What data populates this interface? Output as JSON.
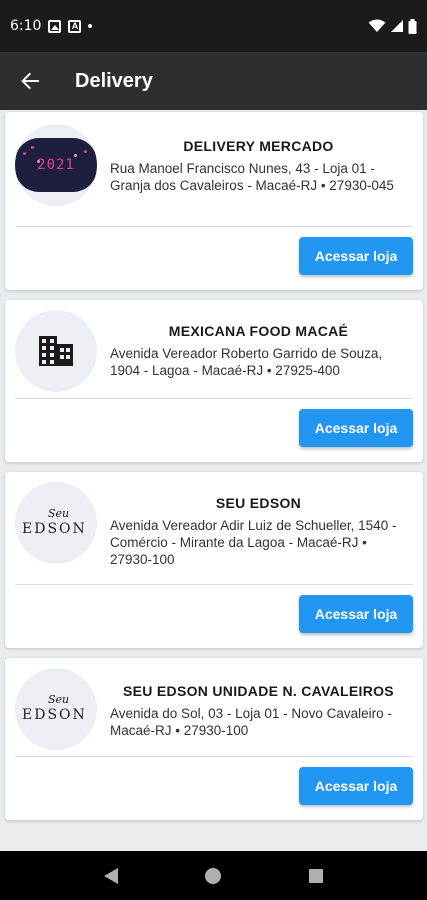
{
  "status_bar": {
    "time": "6:10"
  },
  "app_bar": {
    "title": "Delivery"
  },
  "stores": [
    {
      "name": "DELIVERY  MERCADO",
      "address": "Rua Manoel Francisco Nunes, 43 - Loja 01 - Granja dos Cavaleiros - Macaé-RJ • 27930-045",
      "logo_text": "2021",
      "button": "Acessar loja"
    },
    {
      "name": "MEXICANA FOOD MACAÉ",
      "address": "Avenida Vereador Roberto Garrido de Souza, 1904 - Lagoa - Macaé-RJ • 27925-400",
      "logo_icon": "building-icon",
      "button": "Acessar loja"
    },
    {
      "name": "SEU EDSON",
      "address": "Avenida Vereador Adir Luiz de Schueller, 1540 - Comércio - Mirante da Lagoa - Macaé-RJ • 27930-100",
      "logo_text": "EDSON",
      "logo_script": "Seu",
      "button": "Acessar loja"
    },
    {
      "name": "SEU EDSON UNIDADE N. CAVALEIROS",
      "address": "Avenida do Sol, 03 - Loja 01 - Novo Cavaleiro - Macaé-RJ • 27930-100",
      "logo_text": "EDSON",
      "logo_script": "Seu",
      "button": "Acessar loja"
    }
  ],
  "colors": {
    "accent": "#2196f3",
    "app_bar": "#2d2e30",
    "status_bar": "#1b1b1b",
    "background": "#e9ecef"
  }
}
